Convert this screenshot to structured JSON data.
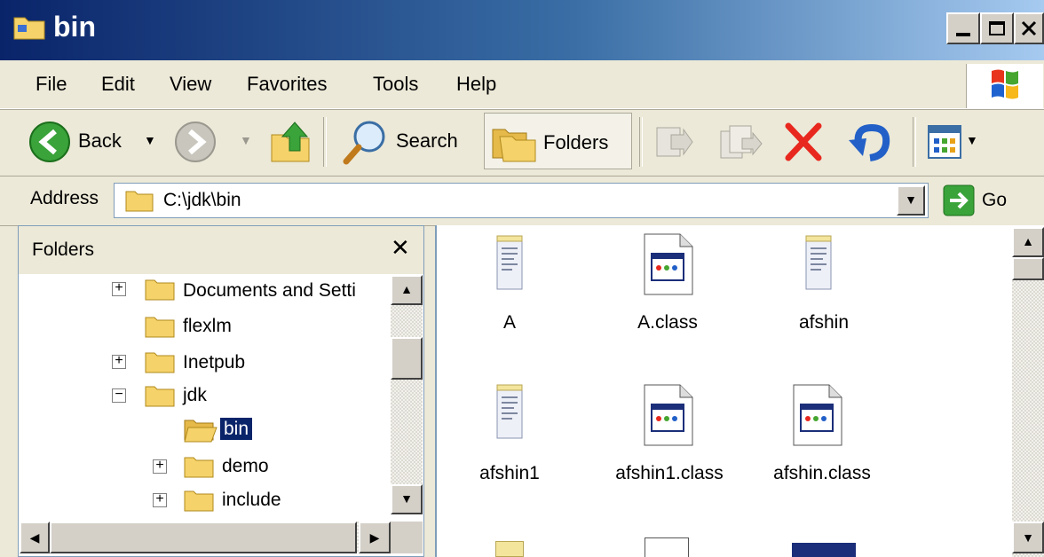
{
  "window": {
    "title": "bin"
  },
  "menu": [
    "File",
    "Edit",
    "View",
    "Favorites",
    "Tools",
    "Help"
  ],
  "toolbar": {
    "back": "Back",
    "search": "Search",
    "folders": "Folders"
  },
  "address": {
    "label": "Address",
    "value": "C:\\jdk\\bin",
    "go": "Go"
  },
  "folders_pane": {
    "title": "Folders",
    "items": [
      {
        "label": "Documents and Setti",
        "expander": "+"
      },
      {
        "label": "flexlm",
        "expander": ""
      },
      {
        "label": "Inetpub",
        "expander": "+"
      },
      {
        "label": "jdk",
        "expander": "−"
      },
      {
        "label": "bin",
        "expander": "",
        "selected": true
      },
      {
        "label": "demo",
        "expander": "+"
      },
      {
        "label": "include",
        "expander": "+"
      }
    ]
  },
  "files": [
    {
      "name": "A",
      "icon": "text-file-icon"
    },
    {
      "name": "A.class",
      "icon": "class-file-icon"
    },
    {
      "name": "afshin",
      "icon": "text-file-icon"
    },
    {
      "name": "afshin1",
      "icon": "text-file-icon"
    },
    {
      "name": "afshin1.class",
      "icon": "class-file-icon"
    },
    {
      "name": "afshin.class",
      "icon": "class-file-icon"
    }
  ],
  "colors": {
    "title_gradient_start": "#0a246a",
    "selection": "#0a246a",
    "delete_red": "#e8281e"
  }
}
